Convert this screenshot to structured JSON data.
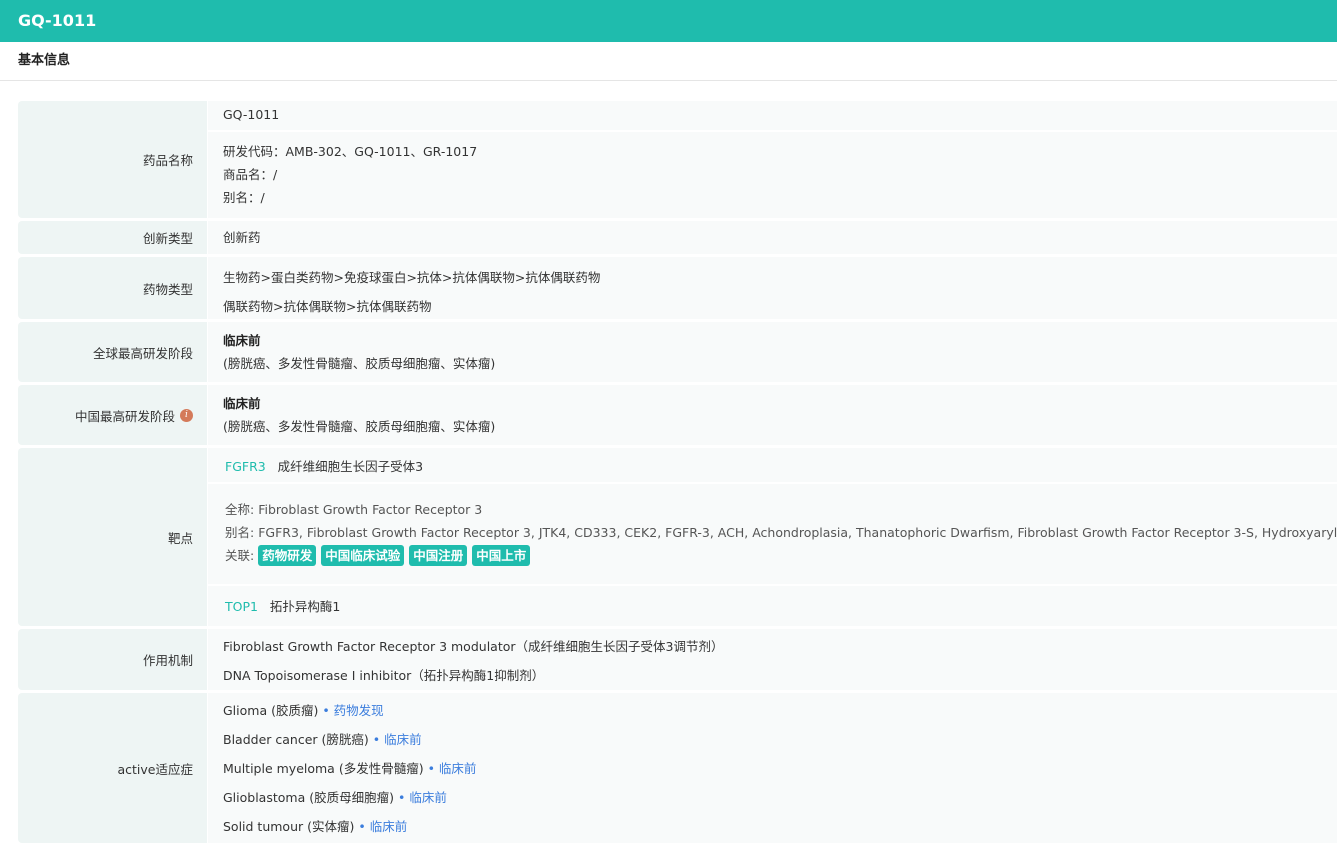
{
  "header": {
    "title": "GQ-1011"
  },
  "section": {
    "title": "基本信息"
  },
  "rows": {
    "name": {
      "label": "药品名称",
      "primary": "GQ-1011",
      "codes": "研发代码：AMB-302、GQ-1011、GR-1017",
      "trade": "商品名：/",
      "alias": "别名：/"
    },
    "innovation": {
      "label": "创新类型",
      "value": "创新药"
    },
    "drug_type": {
      "label": "药物类型",
      "lines": [
        "生物药>蛋白类药物>免疫球蛋白>抗体>抗体偶联物>抗体偶联药物",
        "偶联药物>抗体偶联物>抗体偶联药物"
      ]
    },
    "global_phase": {
      "label": "全球最高研发阶段",
      "phase": "临床前",
      "indications": "(膀胱癌、多发性骨髓瘤、胶质母细胞瘤、实体瘤)"
    },
    "china_phase": {
      "label": "中国最高研发阶段",
      "phase": "临床前",
      "indications": "(膀胱癌、多发性骨髓瘤、胶质母细胞瘤、实体瘤)"
    },
    "targets": {
      "label": "靶点",
      "items": [
        {
          "code": "FGFR3",
          "name": "成纤维细胞生长因子受体3",
          "full_label": "全称:",
          "full": "Fibroblast Growth Factor Receptor 3",
          "alias_label": "别名:",
          "alias": "FGFR3, Fibroblast Growth Factor Receptor 3, JTK4, CD333, CEK2, FGFR-3, ACH, Achondroplasia, Thanatophoric Dwarfism, Fibroblast Growth Factor Receptor 3-S, Hydroxyaryl-Protein Kinase,",
          "related_label": "关联:",
          "tags": [
            "药物研发",
            "中国临床试验",
            "中国注册",
            "中国上市"
          ]
        },
        {
          "code": "TOP1",
          "name": "拓扑异构酶1"
        }
      ]
    },
    "mechanism": {
      "label": "作用机制",
      "lines": [
        "Fibroblast Growth Factor Receptor 3 modulator（成纤维细胞生长因子受体3调节剂）",
        "DNA Topoisomerase I inhibitor（拓扑异构酶1抑制剂）"
      ]
    },
    "indications": {
      "label": "active适应症",
      "items": [
        {
          "name": "Glioma (胶质瘤)",
          "phase": "• 药物发现"
        },
        {
          "name": "Bladder cancer (膀胱癌)",
          "phase": "• 临床前"
        },
        {
          "name": "Multiple myeloma (多发性骨髓瘤)",
          "phase": "• 临床前"
        },
        {
          "name": "Glioblastoma (胶质母细胞瘤)",
          "phase": "• 临床前"
        },
        {
          "name": "Solid tumour (实体瘤)",
          "phase": "• 临床前"
        }
      ]
    }
  },
  "colors": {
    "accent": "#1fbcad",
    "link": "#3b7ddd",
    "info": "#d47a5a"
  }
}
